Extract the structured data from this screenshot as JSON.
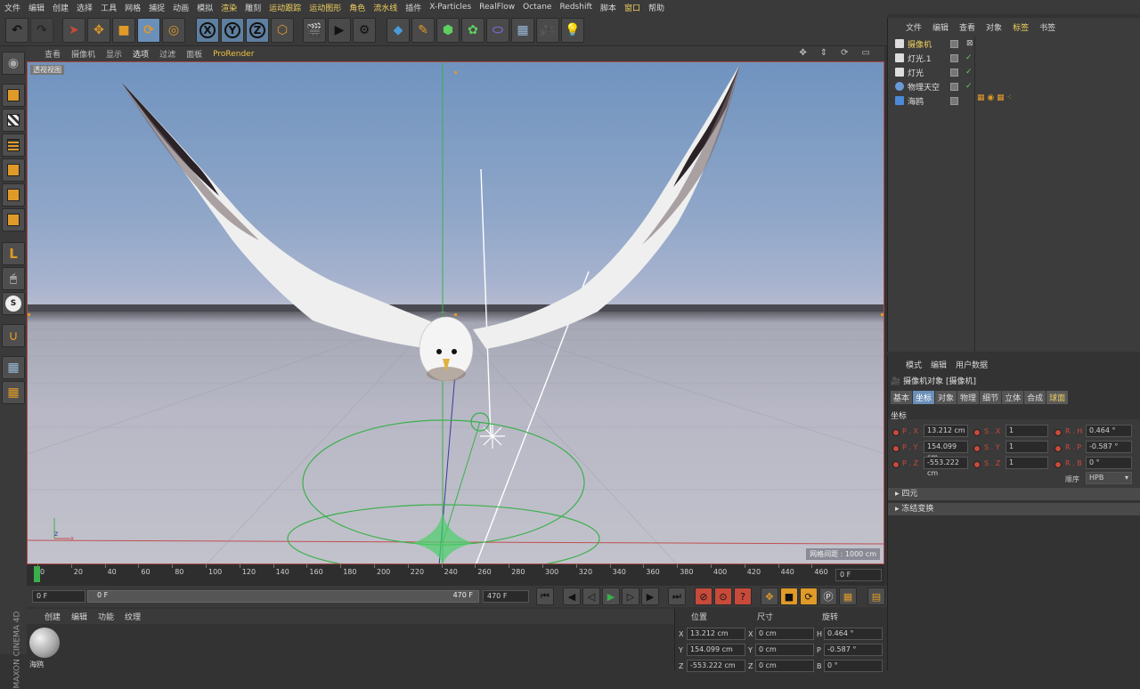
{
  "menu": [
    "文件",
    "编辑",
    "创建",
    "选择",
    "工具",
    "网格",
    "捕捉",
    "动画",
    "模拟",
    "渲染",
    "雕刻",
    "运动跟踪",
    "运动图形",
    "角色",
    "流水线",
    "插件",
    "X-Particles",
    "RealFlow",
    "Octane",
    "Redshift",
    "脚本",
    "窗口",
    "帮助"
  ],
  "toolbar": {
    "x": "X",
    "y": "Y",
    "z": "Z"
  },
  "viewport": {
    "menu": [
      "查看",
      "摄像机",
      "显示",
      "选项",
      "过滤",
      "面板",
      "ProRender"
    ],
    "label": "透视视图",
    "grid_label": "网格间距 : 1000 cm"
  },
  "timeline": {
    "ticks": [
      "0",
      "20",
      "40",
      "60",
      "80",
      "100",
      "120",
      "140",
      "160",
      "180",
      "200",
      "220",
      "240",
      "260",
      "280",
      "300",
      "320",
      "340",
      "360",
      "380",
      "400",
      "420",
      "440",
      "460"
    ],
    "end_field": "0 F"
  },
  "transport": {
    "start": "0 F",
    "range_start": "0 F",
    "range_end": "470 F",
    "end": "470 F"
  },
  "material": {
    "menu": [
      "创建",
      "编辑",
      "功能",
      "纹理"
    ],
    "name": "海鸥"
  },
  "coords": {
    "headers": [
      "位置",
      "尺寸",
      "旋转"
    ],
    "rows": [
      {
        "axis": "X",
        "pos": "13.212 cm",
        "size": "0 cm",
        "rot_axis": "H",
        "rot": "0.464 °"
      },
      {
        "axis": "Y",
        "pos": "154.099 cm",
        "size": "0 cm",
        "rot_axis": "P",
        "rot": "-0.587 °"
      },
      {
        "axis": "Z",
        "pos": "-553.222 cm",
        "size": "0 cm",
        "rot_axis": "B",
        "rot": "0 °"
      }
    ]
  },
  "object_manager": {
    "menu": [
      "文件",
      "编辑",
      "查看",
      "对象",
      "标签",
      "书签"
    ],
    "objects": [
      "摄像机",
      "灯光.1",
      "灯光",
      "物理天空",
      "海鸥"
    ]
  },
  "attribute_manager": {
    "menu": [
      "模式",
      "编辑",
      "用户数据"
    ],
    "title": "摄像机对象 [摄像机]",
    "tabs": [
      "基本",
      "坐标",
      "对象",
      "物理",
      "细节",
      "立体",
      "合成",
      "球面"
    ],
    "section": "坐标",
    "rows": [
      {
        "p_lbl": "P . X",
        "p": "13.212 cm",
        "s_lbl": "S . X",
        "s": "1",
        "r_lbl": "R . H",
        "r": "0.464 °"
      },
      {
        "p_lbl": "P . Y",
        "p": "154.099 cm",
        "s_lbl": "S . Y",
        "s": "1",
        "r_lbl": "R . P",
        "r": "-0.587 °"
      },
      {
        "p_lbl": "P . Z",
        "p": "-553.222 cm",
        "s_lbl": "S . Z",
        "s": "1",
        "r_lbl": "R . B",
        "r": "0 °"
      }
    ],
    "order_label": "顺序",
    "order_value": "HPB",
    "fold1": "四元",
    "fold2": "冻结变换"
  },
  "brand": "MAXON CINEMA 4D"
}
